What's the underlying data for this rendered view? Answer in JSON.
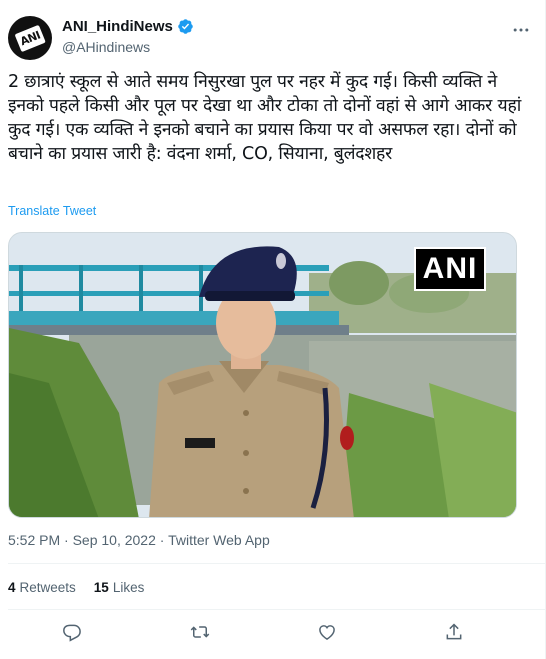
{
  "author": {
    "display_name": "ANI_HindiNews",
    "handle": "@AHindinews",
    "avatar_text": "ANI",
    "verified": true
  },
  "tweet": {
    "text": "2 छात्राएं स्कूल से आते समय निसुरखा पुल पर नहर में कुद गई। किसी व्यक्ति ने इनको पहले किसी और पूल पर देखा था और टोका तो दोनों वहां से आगे आकर यहां कुद गई। एक व्यक्ति ने इनको बचाने का प्रयास किया पर वो असफल रहा। दोनों को बचाने का प्रयास जारी है: वंदना शर्मा, CO, सियाना, बुलंदशहर",
    "translate_label": "Translate Tweet",
    "media_watermark": "ANI",
    "timestamp": "5:52 PM · Sep 10, 2022 · Twitter Web App"
  },
  "stats": {
    "retweets_count": "4",
    "retweets_label": "Retweets",
    "likes_count": "15",
    "likes_label": "Likes"
  },
  "icons": {
    "verified": "verified-badge-icon",
    "more": "more-icon",
    "reply": "reply-icon",
    "retweet": "retweet-icon",
    "like": "heart-icon",
    "share": "share-icon"
  },
  "colors": {
    "accent": "#1d9bf0",
    "secondary_text": "#536471",
    "primary_text": "#0f1419"
  }
}
